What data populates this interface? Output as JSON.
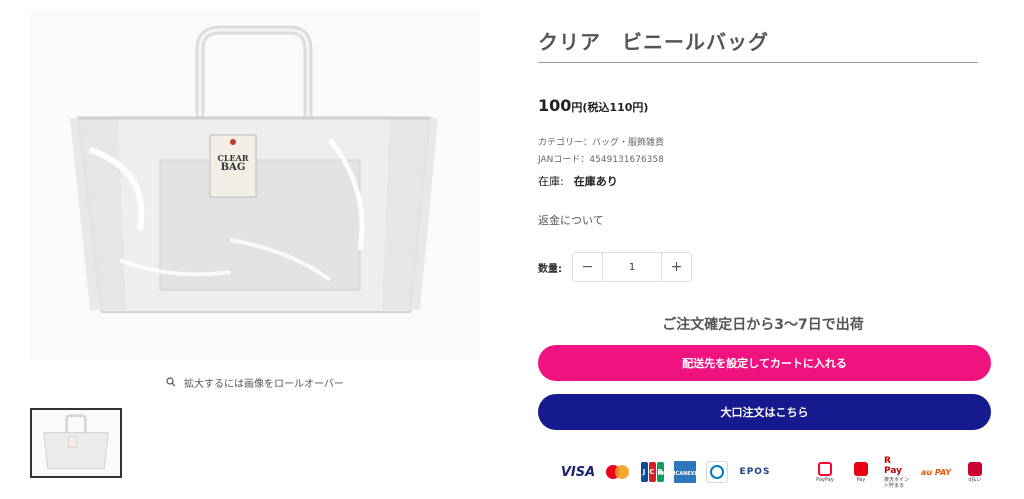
{
  "product": {
    "title": "クリア　ビニールバッグ",
    "price": "100",
    "price_suffix": "円(税込110円)",
    "category_text": "カテゴリー：バッグ・服飾雑貨",
    "jan_text": "JANコード：4549131676358",
    "stock_label": "在庫:",
    "stock_value": "在庫あり",
    "refund_link": "返金について"
  },
  "gallery": {
    "zoom_hint": "拡大するには画像をロールオーバー",
    "tag_lines": [
      "CLEAR",
      "BAG"
    ]
  },
  "quantity": {
    "label": "数量:",
    "value": "1",
    "minus": "−",
    "plus": "+"
  },
  "shipping_note": "ご注文確定日から3〜7日で出荷",
  "buttons": {
    "add_to_cart": "配送先を設定してカートに入れる",
    "bulk_order": "大口注文はこちら"
  },
  "payments": {
    "visa": "VISA",
    "jcb": [
      "J",
      "C",
      "B"
    ],
    "amex": [
      "AMERICAN",
      "EXPRESS"
    ],
    "epos": "EPOS",
    "paypay_caption": "PayPay",
    "applepay_caption": "Pay",
    "rpay": "R Pay",
    "rpay_caption": "楽天ポイント貯まる",
    "aupay": "au PAY",
    "dpay_caption": "d払い"
  },
  "colors": {
    "cart_button": "#f0127f",
    "bulk_button": "#161a8f"
  }
}
